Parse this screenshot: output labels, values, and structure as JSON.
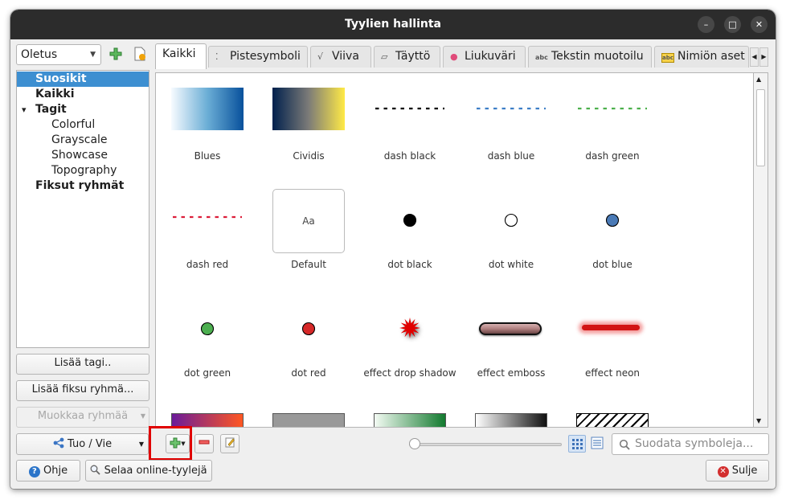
{
  "window": {
    "title": "Tyylien hallinta"
  },
  "window_controls": {
    "minimize": "–",
    "maximize": "□",
    "close": "✕"
  },
  "left": {
    "style_db": "Oletus",
    "tree": [
      {
        "label": "Suosikit",
        "bold": true,
        "selected": true,
        "indent": 0
      },
      {
        "label": "Kaikki",
        "bold": true,
        "indent": 0
      },
      {
        "label": "Tagit",
        "bold": true,
        "indent": 0,
        "expanded": true
      },
      {
        "label": "Colorful",
        "bold": false,
        "indent": 2
      },
      {
        "label": "Grayscale",
        "bold": false,
        "indent": 2
      },
      {
        "label": "Showcase",
        "bold": false,
        "indent": 2
      },
      {
        "label": "Topography",
        "bold": false,
        "indent": 2
      },
      {
        "label": "Fiksut ryhmät",
        "bold": true,
        "indent": 0
      }
    ],
    "buttons": {
      "add_tag": "Lisää tagi..",
      "add_smart_group": "Lisää fiksu ryhmä...",
      "edit_group": "Muokkaa ryhmää"
    }
  },
  "tabs": [
    {
      "label": "Kaikki",
      "icon": "",
      "active": true
    },
    {
      "label": "Pistesymboli",
      "icon": "point-marker-icon"
    },
    {
      "label": "Viiva",
      "icon": "line-icon"
    },
    {
      "label": "Täyttö",
      "icon": "fill-icon"
    },
    {
      "label": "Liukuväri",
      "icon": "color-ramp-icon"
    },
    {
      "label": "Tekstin muotoilu",
      "icon": "text-format-icon"
    },
    {
      "label": "Nimiön aset",
      "icon": "label-settings-icon"
    }
  ],
  "tab_icon_glyphs": {
    "point": "⁚",
    "line": "√",
    "fill": "▱",
    "ramp": "●",
    "text": "abc",
    "label": "abc"
  },
  "symbols": [
    {
      "name": "Blues",
      "kind": "gradient",
      "colors": [
        "#f7fbff",
        "#6baed6",
        "#08519c"
      ]
    },
    {
      "name": "Cividis",
      "kind": "gradient",
      "colors": [
        "#00204d",
        "#7c7b78",
        "#ffea46"
      ]
    },
    {
      "name": "dash  black",
      "kind": "dash",
      "color": "#000000"
    },
    {
      "name": "dash blue",
      "kind": "dash",
      "color": "#3d7fc7"
    },
    {
      "name": "dash green",
      "kind": "dash",
      "color": "#4cb04c"
    },
    {
      "name": "dash red",
      "kind": "dash",
      "color": "#dc1e3a"
    },
    {
      "name": "Default",
      "kind": "text",
      "text": "Aa"
    },
    {
      "name": "dot  black",
      "kind": "dot",
      "color": "#000000"
    },
    {
      "name": "dot  white",
      "kind": "dot",
      "color": "#ffffff"
    },
    {
      "name": "dot blue",
      "kind": "dot",
      "color": "#4a7ab6"
    },
    {
      "name": "dot green",
      "kind": "dot",
      "color": "#4caf50"
    },
    {
      "name": "dot red",
      "kind": "dot",
      "color": "#d62828"
    },
    {
      "name": "effect drop shadow",
      "kind": "star",
      "color": "#e00000"
    },
    {
      "name": "effect emboss",
      "kind": "emboss",
      "color": "#b08080"
    },
    {
      "name": "effect neon",
      "kind": "neon",
      "color": "#d21414"
    },
    {
      "name": "",
      "kind": "partial",
      "colors": [
        "#6a1b9a",
        "#ff5722"
      ]
    },
    {
      "name": "",
      "kind": "partial",
      "colors": [
        "#999999",
        "#999999"
      ]
    },
    {
      "name": "",
      "kind": "partial",
      "colors": [
        "#f3fbf3",
        "#137a2f"
      ]
    },
    {
      "name": "",
      "kind": "partial",
      "colors": [
        "#ffffff",
        "#111111"
      ]
    },
    {
      "name": "",
      "kind": "hatch",
      "colors": [
        "#ffffff",
        "#000000"
      ]
    }
  ],
  "bottom": {
    "import_export": "Tuo / Vie",
    "help": "Ohje",
    "browse_online": "Selaa online-tyylejä",
    "close": "Sulje",
    "search_placeholder": "Suodata symboleja...",
    "zoom": 0
  },
  "colors": {
    "highlight": "#3d8fd1",
    "annotation_red": "#e00000",
    "accent_green": "#3a9a3a"
  }
}
